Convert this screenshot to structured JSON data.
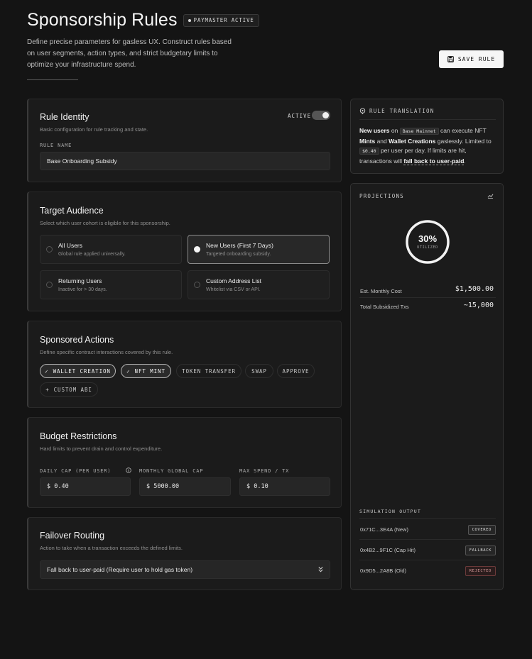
{
  "header": {
    "title": "Sponsorship Rules",
    "status_badge": "PAYMASTER ACTIVE",
    "description": "Define precise parameters for gasless UX. Construct rules based on user segments, action types, and strict budgetary limits to optimize your infrastructure spend.",
    "save_label": "SAVE RULE"
  },
  "identity": {
    "title": "Rule Identity",
    "subtitle": "Basic configuration for rule tracking and state.",
    "active_label": "ACTIVE",
    "active": true,
    "rule_name_label": "RULE NAME",
    "rule_name_value": "Base Onboarding Subsidy"
  },
  "audience": {
    "title": "Target Audience",
    "subtitle": "Select which user cohort is eligible for this sponsorship.",
    "options": [
      {
        "title": "All Users",
        "desc": "Global rule applied universally.",
        "selected": false
      },
      {
        "title": "New Users (First 7 Days)",
        "desc": "Targeted onboarding subsidy.",
        "selected": true
      },
      {
        "title": "Returning Users",
        "desc": "Inactive for > 30 days.",
        "selected": false
      },
      {
        "title": "Custom Address List",
        "desc": "Whitelist via CSV or API.",
        "selected": false
      }
    ]
  },
  "actions": {
    "title": "Sponsored Actions",
    "subtitle": "Define specific contract interactions covered by this rule.",
    "chips": [
      {
        "label": "WALLET CREATION",
        "on": true
      },
      {
        "label": "NFT MINT",
        "on": true
      },
      {
        "label": "TOKEN TRANSFER",
        "on": false
      },
      {
        "label": "SWAP",
        "on": false
      },
      {
        "label": "APPROVE",
        "on": false
      },
      {
        "label": "CUSTOM ABI",
        "on": false
      }
    ]
  },
  "budget": {
    "title": "Budget Restrictions",
    "subtitle": "Hard limits to prevent drain and control expenditure.",
    "fields": [
      {
        "label": "DAILY CAP (PER USER)",
        "value": "$ 0.40"
      },
      {
        "label": "MONTHLY GLOBAL CAP",
        "value": "$ 5000.00"
      },
      {
        "label": "MAX SPEND / TX",
        "value": "$ 0.10"
      }
    ]
  },
  "failover": {
    "title": "Failover Routing",
    "subtitle": "Action to take when a transaction exceeds the defined limits.",
    "selected": "Fall back to user-paid (Require user to hold gas token)"
  },
  "translation": {
    "header": "RULE TRANSLATION",
    "p1": "New users",
    "p2": " on ",
    "network": "Base Mainnet",
    "p3": " can execute NFT ",
    "p4": "Mints",
    "p5": " and ",
    "p6": "Wallet Creations",
    "p7": " gaslessly. Limited to ",
    "limit": "$0.40",
    "p8": " per user per day. If limits are hit, transactions will ",
    "p9": "fall back to user-paid",
    "p10": "."
  },
  "projections": {
    "header": "PROJECTIONS",
    "utilization_value": "30%",
    "utilization_fraction": 0.3,
    "utilization_label": "UTILIZED",
    "monthly_cost_label": "Est. Monthly Cost",
    "monthly_cost_value": "$1,500.00",
    "txs_label": "Total Subsidized Txs",
    "txs_value": "~15,000",
    "simulation_header": "SIMULATION OUTPUT",
    "simulations": [
      {
        "label": "0x71C...3E4A (New)",
        "status": "COVERED"
      },
      {
        "label": "0x4B2...9F1C (Cap Hit)",
        "status": "FALLBACK"
      },
      {
        "label": "0x9D5...2A8B (Old)",
        "status": "REJECTED"
      }
    ]
  }
}
